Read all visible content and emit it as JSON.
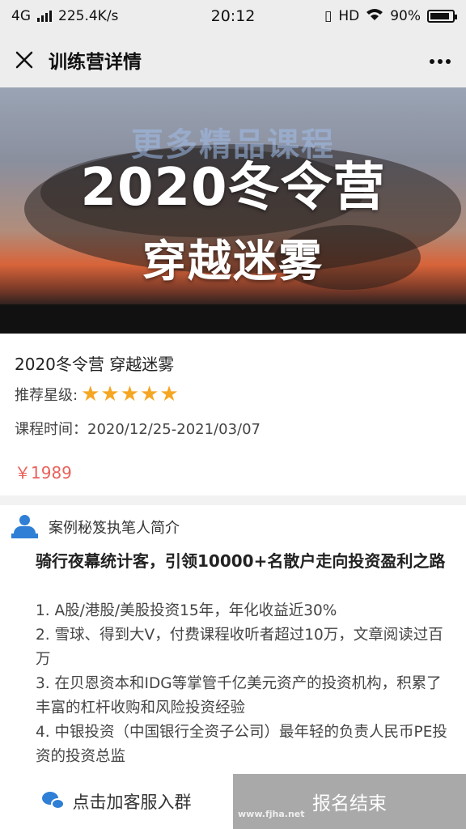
{
  "status_bar": {
    "network": "4G",
    "speed": "225.4K/s",
    "time": "20:12",
    "hd": "HD",
    "battery": "90%",
    "battery_level": 0.9
  },
  "title_bar": {
    "close_icon": "close-icon",
    "title": "训练营详情",
    "more_icon": "more-icon"
  },
  "banner": {
    "line1": "2020冬令营",
    "line2": "穿越迷雾",
    "watermark": "更多精品课程"
  },
  "course": {
    "name": "2020冬令营 穿越迷雾",
    "rating_label": "推荐星级:",
    "rating": 5,
    "rating_max": 5,
    "star_color": "#f5a623",
    "time_label": "课程时间：",
    "time_value": "2020/12/25-2021/03/07",
    "price": "￥1989",
    "price_color": "#e9625b"
  },
  "author_section": {
    "icon": "person-icon",
    "title": "案例秘笈执笔人简介",
    "headline": "骑行夜幕统计客，引领10000+名散户走向投资盈利之路",
    "points": [
      "1. A股/港股/美股投资15年，年化收益近30%",
      "2. 雪球、得到大V，付费课程收听者超过10万，文章阅读过百万",
      "3. 在贝恩资本和IDG等掌管千亿美元资产的投资机构，积累了丰富的杠杆收购和风险投资经验",
      "4. 中银投资（中国银行全资子公司）最年轻的负责人民币PE投资的投资总监"
    ]
  },
  "bottom_bar": {
    "service_icon": "wechat-icon",
    "service_label": "点击加客服入群",
    "enroll_label": "报名结束",
    "enroll_watermark": "www.fjha.net",
    "accent": "#2f7fd6",
    "enroll_bg": "#a9a9a9"
  }
}
